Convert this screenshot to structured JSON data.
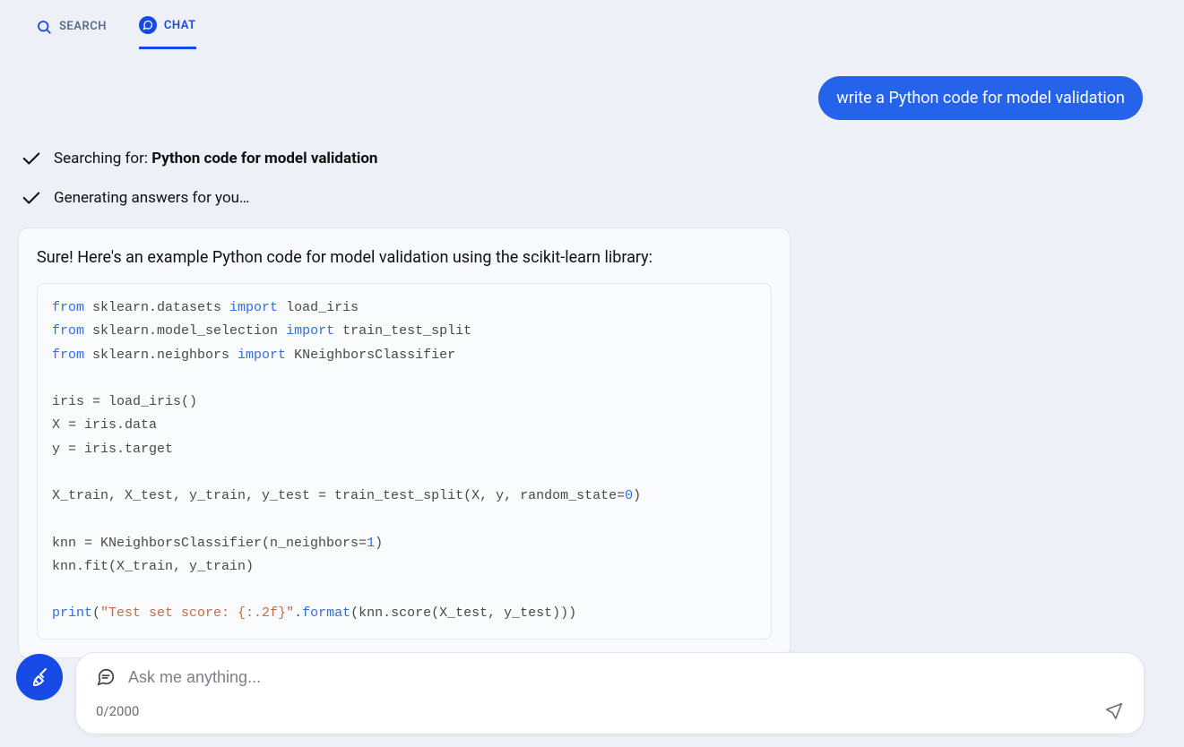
{
  "tabs": {
    "search": "SEARCH",
    "chat": "CHAT"
  },
  "user_message": "write a Python code for model validation",
  "status": {
    "searching_prefix": "Searching for: ",
    "searching_query": "Python code for model validation",
    "generating": "Generating answers for you…"
  },
  "assistant": {
    "intro": "Sure! Here's an example Python code for model validation using the scikit-learn library:",
    "code": {
      "l1": {
        "a": "from",
        "b": " sklearn.datasets ",
        "c": "import",
        "d": " load_iris"
      },
      "l2": {
        "a": "from",
        "b": " sklearn.model_selection ",
        "c": "import",
        "d": " train_test_split"
      },
      "l3": {
        "a": "from",
        "b": " sklearn.neighbors ",
        "c": "import",
        "d": " KNeighborsClassifier"
      },
      "l5": "iris = load_iris()",
      "l6": "X = iris.data",
      "l7": "y = iris.target",
      "l9a": "X_train, X_test, y_train, y_test = train_test_split(X, y, random_state=",
      "l9n": "0",
      "l9b": ")",
      "l11a": "knn = KNeighborsClassifier(n_neighbors=",
      "l11n": "1",
      "l11b": ")",
      "l12": "knn.fit(X_train, y_train)",
      "l14a": "print",
      "l14b": "(",
      "l14s": "\"Test set score: {:.2f}\"",
      "l14c": ".",
      "l14f": "format",
      "l14d": "(knn.score(X_test, y_test)))"
    }
  },
  "composer": {
    "placeholder": "Ask me anything...",
    "counter": "0/2000"
  }
}
